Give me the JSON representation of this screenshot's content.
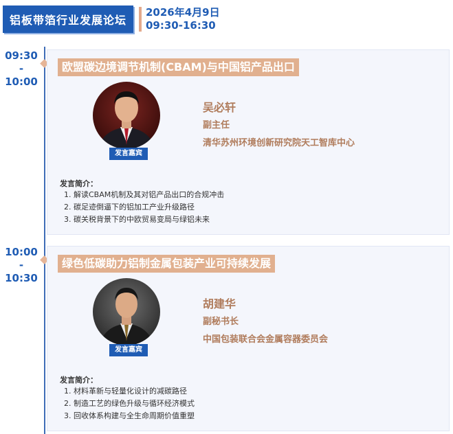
{
  "header": {
    "tag": "铝板带箔行业发展论坛",
    "date": "2026年4月9日",
    "time": "09:30-16:30"
  },
  "sessions": [
    {
      "time_start": "09:30",
      "dash": "-",
      "time_end": "10:00",
      "title": "欧盟碳边境调节机制(CBAM)与中国铝产品出口",
      "badge": "发言嘉宾",
      "speaker_name": "吴必轩",
      "speaker_role": "副主任",
      "speaker_org": "清华苏州环境创新研究院天工智库中心",
      "intro_label": "发言简介：",
      "intro_items": [
        "1. 解读CBAM机制及其对铝产品出口的合规冲击",
        "2. 碳足迹倒逼下的铝加工产业升级路径",
        "3. 碳关税背景下的中欧贸易变局与绿铝未来"
      ]
    },
    {
      "time_start": "10:00",
      "dash": "-",
      "time_end": "10:30",
      "title": "绿色低碳助力铝制金属包装产业可持续发展",
      "badge": "发言嘉宾",
      "speaker_name": "胡建华",
      "speaker_role": "副秘书长",
      "speaker_org": "中国包装联合会金属容器委员会",
      "intro_label": "发言简介：",
      "intro_items": [
        "1. 材料革新与轻量化设计的减碳路径",
        "2. 制造工艺的绿色升级与循环经济模式",
        "3. 回收体系构建与全生命周期价值重塑"
      ]
    }
  ],
  "colors": {
    "brand_blue": "#1f5cb4",
    "accent_peach": "#e1b08f",
    "speaker_brown": "#b07c5c",
    "card_bg": "#f4f6fc"
  }
}
